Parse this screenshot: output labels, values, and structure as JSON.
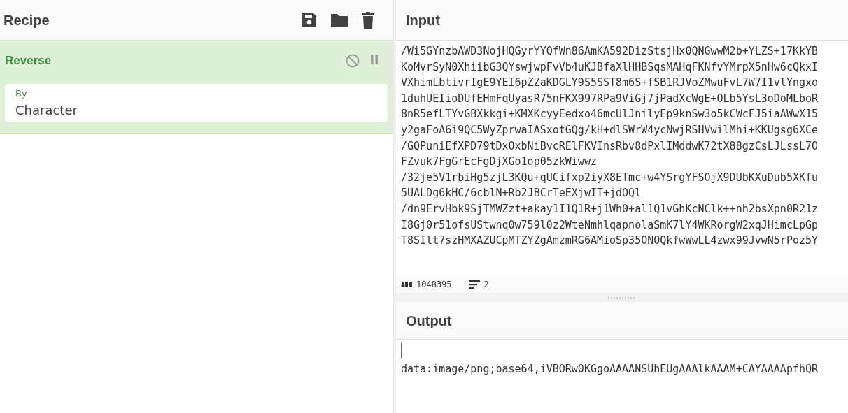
{
  "recipe": {
    "title": "Recipe",
    "operations": [
      {
        "name": "Reverse",
        "disabled": false,
        "breakpoint": false,
        "args": [
          {
            "label": "By",
            "value": "Character"
          }
        ]
      }
    ]
  },
  "input": {
    "title": "Input",
    "lines": [
      "/Wi5GYnzbAWD3NojHQGyrYYQfWn86AmKA592DizStsjHx0QNGwwM2b+YLZS+17KkYB",
      "KoMvrSyN0XhiibG3QYswjwpFvVb4uKJBfaXlHHBSqsMAHqFKNfvYMrpX5nHw6cQkxI",
      "VXhimLbtivrIgE9YEI6pZZaKDGLY9S5SST8m6S+fSB1RJVoZMwuFvL7W7I1vlYngxo",
      "1duhUEIioDUfEHmFqUyasR75nFKX997RPa9ViGj7jPadXcWgE+OLb5YsL3oDoMLboR",
      "8nR5efLTYvGBXkkgi+KMXKcyyEedxo46mcUlJnilyEp9knSw3o5kCWcFJ5iaAWwX15",
      "y2gaFoA6i9QC5WyZprwaIASxotGQg/kH+dlSWrW4ycNwjRSHVwilMhi+KKUgsg6XCe",
      "/GQPuniEfXPD79tDxOxbNiBvcRElFKVInsRbv8dPxlIMddwK72tX88gzCsLJLssL7O",
      "FZvuk7FgGrEcFgDjXGo1op05zkWiwwz",
      "/32je5V1rbiHg5zjL3KQu+qUCifxp2iyX8ETmc+w4YSrgYFSOjX9DUbKXuDub5XKfu",
      "5UALDg6kHC/6cblN+Rb2JBCrTeEXjwIT+jdOQl",
      "/dn9ErvHbk9SjTMWZzt+akay1I1Q1R+j1Wh0+al1Q1vGhKcNClk++nh2bsXpn0R21z",
      "I8Gj0r51ofsUStwnq0w759l0z2WteNmhlqapnolaSmK7lY4WKRorgW2xqJHimcLpGp",
      "T8SIlt7szHMXAZUCpMTZYZgAmzmRG6AMioSp35ONOQkfwWwLL4zwx99JvwN5rPoz5Y"
    ],
    "status": {
      "length": "1048395",
      "lines": "2"
    }
  },
  "output": {
    "title": "Output",
    "lines": [
      "data:image/png;base64,iVBORw0KGgoAAAANSUhEUgAAAlkAAAM+CAYAAAApfhQR"
    ]
  }
}
